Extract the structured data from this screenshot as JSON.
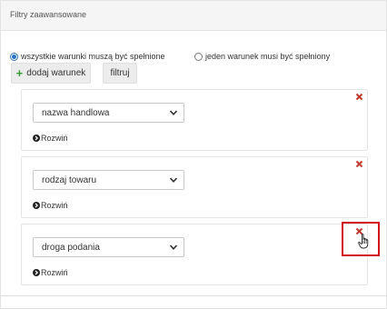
{
  "panel": {
    "title": "Filtry zaawansowane"
  },
  "match_mode": {
    "all": "wszystkie warunki muszą być spełnione",
    "any": "jeden warunek musi być spełniony",
    "selected": "all"
  },
  "actions": {
    "add_condition": "dodaj warunek",
    "filter": "filtruj"
  },
  "conditions": [
    {
      "field": "nazwa handlowa",
      "expand_label": "Rozwiń"
    },
    {
      "field": "rodzaj towaru",
      "expand_label": "Rozwiń"
    },
    {
      "field": "droga podania",
      "expand_label": "Rozwiń"
    }
  ],
  "colors": {
    "accent": "#2a74c9",
    "remove": "#c0392b",
    "add_icon": "#3a9a3a",
    "highlight": "#d4121a"
  },
  "icons": {
    "add": "plus-icon",
    "select": "chevron-down-icon",
    "expand": "circle-arrow-right-icon",
    "remove": "close-icon",
    "cursor": "hand-pointer-icon"
  }
}
